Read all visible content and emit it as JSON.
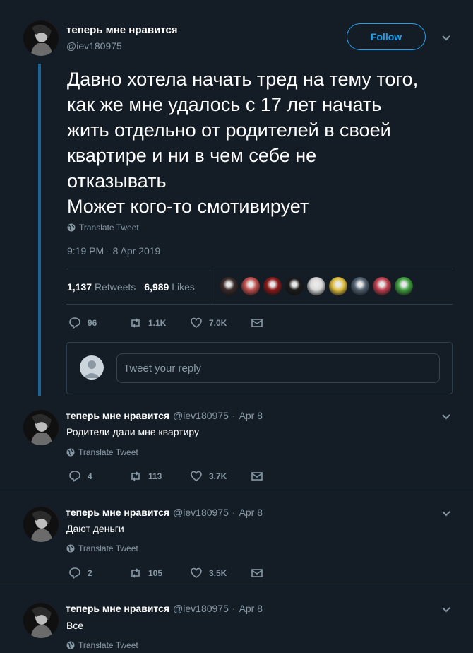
{
  "main_tweet": {
    "author_name": "теперь мне нравится",
    "handle": "@iev180975",
    "follow_label": "Follow",
    "text": "Давно хотела начать тред на тему того,\nкак же мне удалось с 17 лет начать\nжить отдельно от родителей в своей\nквартире и ни в чем себе не\nотказывать\nМожет кого-то смотивирует",
    "translate_label": "Translate Tweet",
    "timestamp": "9:19 PM - 8 Apr 2019",
    "retweets_count": "1,137",
    "retweets_label": "Retweets",
    "likes_count": "6,989",
    "likes_label": "Likes",
    "actions": {
      "replies": "96",
      "retweets": "1.1K",
      "likes": "7.0K"
    },
    "reply_placeholder": "Tweet your reply",
    "liker_avatar_colors": [
      "#3a2a2a",
      "#c0504d",
      "#8b1a1a",
      "#1a1a1a",
      "#d8d8d8",
      "#e0c040",
      "#506070",
      "#c04050",
      "#40a040"
    ]
  },
  "replies": [
    {
      "author_name": "теперь мне нравится",
      "handle": "@iev180975",
      "date": "Apr 8",
      "text": "Родители дали мне квартиру",
      "translate_label": "Translate Tweet",
      "actions": {
        "replies": "4",
        "retweets": "113",
        "likes": "3.7K"
      }
    },
    {
      "author_name": "теперь мне нравится",
      "handle": "@iev180975",
      "date": "Apr 8",
      "text": "Дают деньги",
      "translate_label": "Translate Tweet",
      "actions": {
        "replies": "2",
        "retweets": "105",
        "likes": "3.5K"
      }
    },
    {
      "author_name": "теперь мне нравится",
      "handle": "@iev180975",
      "date": "Apr 8",
      "text": "Все",
      "translate_label": "Translate Tweet"
    }
  ],
  "separator": "·",
  "colors": {
    "background": "#141d26",
    "accent": "#1da1f2",
    "muted": "#8899a6",
    "thread_line": "#1c6397"
  }
}
